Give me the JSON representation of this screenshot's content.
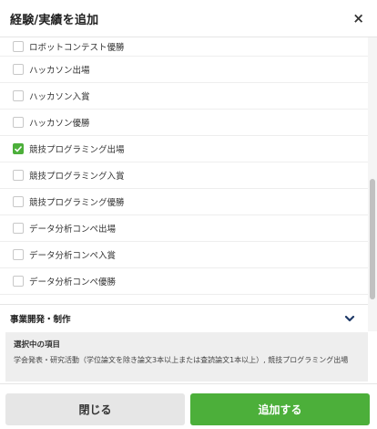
{
  "header": {
    "title": "経験/実績を追加",
    "close_label": "×"
  },
  "list": {
    "items": [
      {
        "label": "ロボットコンテスト優勝",
        "checked": false
      },
      {
        "label": "ハッカソン出場",
        "checked": false
      },
      {
        "label": "ハッカソン入賞",
        "checked": false
      },
      {
        "label": "ハッカソン優勝",
        "checked": false
      },
      {
        "label": "競技プログラミング出場",
        "checked": true
      },
      {
        "label": "競技プログラミング入賞",
        "checked": false
      },
      {
        "label": "競技プログラミング優勝",
        "checked": false
      },
      {
        "label": "データ分析コンペ出場",
        "checked": false
      },
      {
        "label": "データ分析コンペ入賞",
        "checked": false
      },
      {
        "label": "データ分析コンペ優勝",
        "checked": false
      }
    ]
  },
  "section": {
    "title": "事業開発・制作",
    "icon": "chevron-down-icon"
  },
  "selected": {
    "title": "選択中の項目",
    "text": "学会発表・研究活動（学位論文を除き論文3本以上または査読論文1本以上）, 競技プログラミング出場"
  },
  "footer": {
    "close_label": "閉じる",
    "add_label": "追加する"
  },
  "colors": {
    "accent": "#4caf3a",
    "secondary_button": "#e6e6e6",
    "selected_bg": "#eeeeee",
    "chevron": "#1f3a68"
  }
}
